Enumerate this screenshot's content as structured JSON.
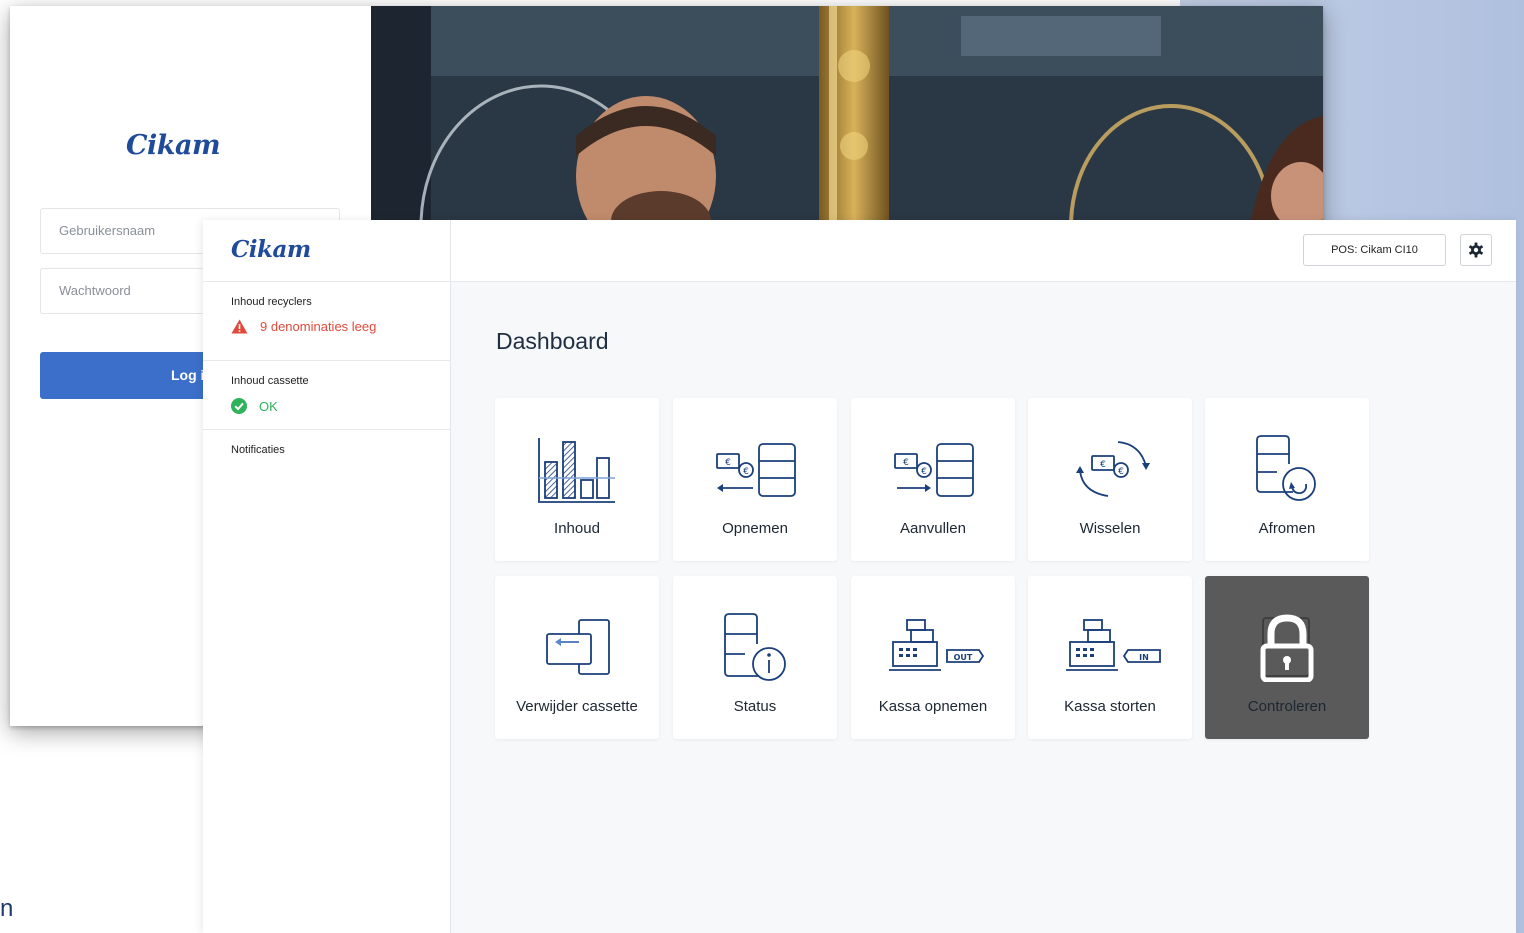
{
  "login": {
    "logo": "Cikam",
    "username_placeholder": "Gebruikersnaam",
    "password_placeholder": "Wachtwoord",
    "login_button": "Log i"
  },
  "edge_text": "n",
  "dashboard": {
    "logo": "Cikam",
    "pos_label": "POS: Cikam CI10",
    "title": "Dashboard",
    "sidebar": {
      "recyclers_label": "Inhoud recyclers",
      "recyclers_status": "9 denominaties leeg",
      "cassette_label": "Inhoud cassette",
      "cassette_status": "OK",
      "notifications_label": "Notificaties"
    },
    "tiles": [
      {
        "label": "Inhoud",
        "icon": "bar-chart-icon"
      },
      {
        "label": "Opnemen",
        "icon": "withdraw-icon"
      },
      {
        "label": "Aanvullen",
        "icon": "replenish-icon"
      },
      {
        "label": "Wisselen",
        "icon": "exchange-icon"
      },
      {
        "label": "Afromen",
        "icon": "skim-icon"
      },
      {
        "label": "Verwijder cassette",
        "icon": "remove-cassette-icon"
      },
      {
        "label": "Status",
        "icon": "status-info-icon"
      },
      {
        "label": "Kassa opnemen",
        "icon": "register-out-icon",
        "badge": "OUT"
      },
      {
        "label": "Kassa storten",
        "icon": "register-in-icon",
        "badge": "IN"
      },
      {
        "label": "Controleren",
        "icon": "lock-icon",
        "locked": true
      }
    ]
  },
  "colors": {
    "brand": "#1f4b9a",
    "primary_button": "#3b6fc9",
    "icon_blue": "#1b3f7a",
    "warning": "#e04a3b",
    "ok": "#2fb25a",
    "locked_tile": "#5a5a5a"
  }
}
